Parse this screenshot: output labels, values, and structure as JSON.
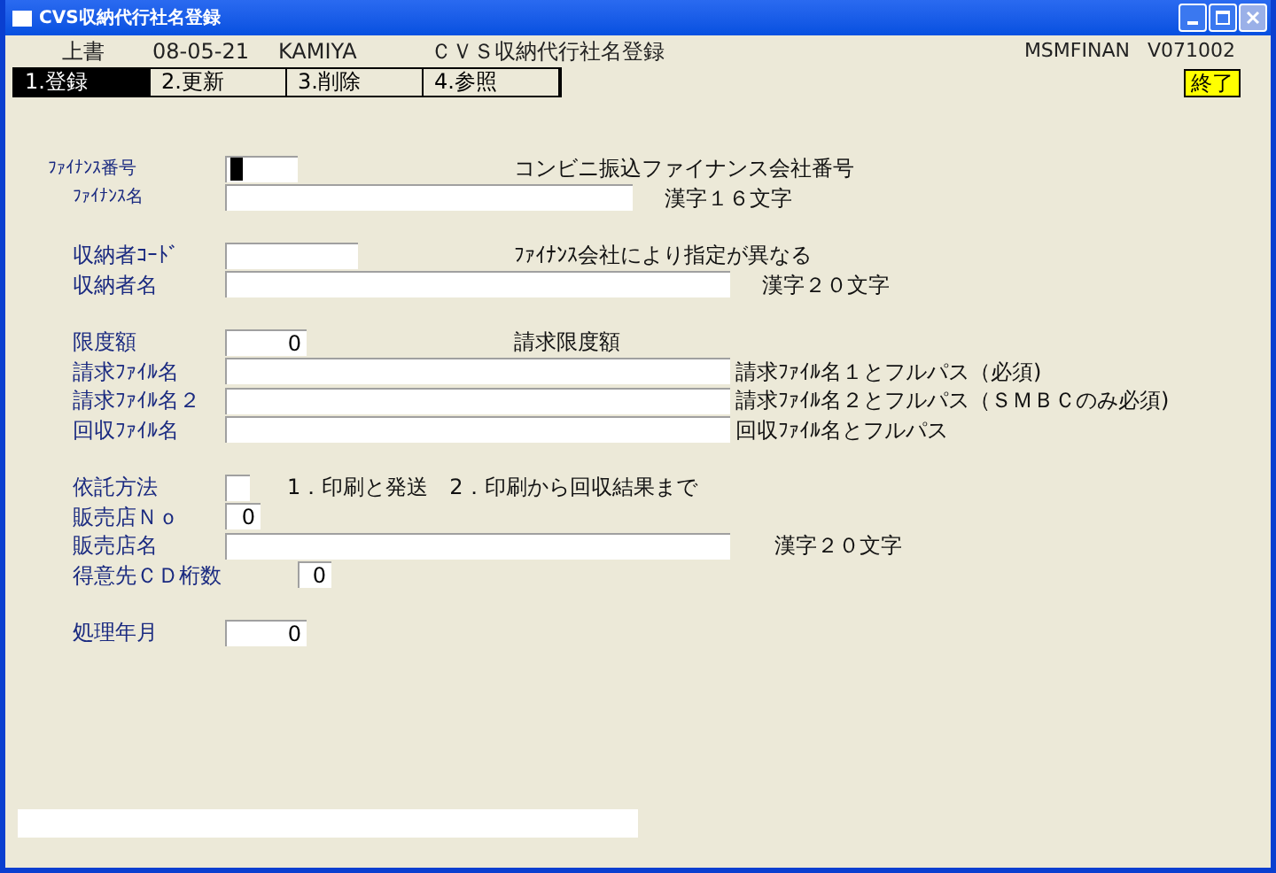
{
  "window": {
    "title": "CVS収納代行社名登録"
  },
  "header": {
    "mode": "上書",
    "date": "08-05-21",
    "user": "KAMIYA",
    "screen_title": "ＣＶＳ収納代行社名登録",
    "program_id": "MSMFINAN",
    "version": "V071002"
  },
  "tabs": [
    {
      "label": "1.登録",
      "selected": true
    },
    {
      "label": "2.更新",
      "selected": false
    },
    {
      "label": "3.削除",
      "selected": false
    },
    {
      "label": "4.参照",
      "selected": false
    }
  ],
  "exit_button": "終了",
  "sections": [
    {
      "rows": [
        {
          "label": "ﾌｧｲﾅﾝｽ番号",
          "focused": true,
          "note": "コンビニ振込ファイナンス会社番号"
        },
        {
          "label": "ﾌｧｲﾅﾝｽ名",
          "focused": false,
          "note": "漢字１６文字"
        }
      ]
    },
    {
      "rows": [
        {
          "label": "収納者ｺｰﾄﾞ",
          "focused": false,
          "note": "ﾌｧｲﾅﾝｽ会社により指定が異なる"
        },
        {
          "label": "収納者名",
          "focused": false,
          "note": "漢字２０文字"
        }
      ]
    },
    {
      "rows": [
        {
          "label": "限度額",
          "value": "0",
          "focused": false,
          "note": "請求限度額"
        },
        {
          "label": "請求ﾌｧｲﾙ名",
          "focused": false,
          "note": "請求ﾌｧｲﾙ名１とフルパス（必須)"
        },
        {
          "label": "請求ﾌｧｲﾙ名２",
          "focused": false,
          "note": "請求ﾌｧｲﾙ名２とフルパス（ＳＭＢＣのみ必須)"
        },
        {
          "label": "回収ﾌｧｲﾙ名",
          "focused": false,
          "note": "回収ﾌｧｲﾙ名とフルパス"
        }
      ]
    },
    {
      "rows": [
        {
          "label": "依託方法",
          "focused": false,
          "note": "1．印刷と発送　2．印刷から回収結果まで"
        },
        {
          "label": "販売店Ｎｏ",
          "value": "0",
          "focused": false
        },
        {
          "label": "販売店名",
          "focused": false,
          "note": "漢字２０文字"
        },
        {
          "label": "得意先ＣＤ桁数",
          "value": "0",
          "focused": false
        }
      ]
    },
    {
      "rows": [
        {
          "label": "処理年月",
          "value": "0",
          "focused": false
        }
      ]
    }
  ]
}
